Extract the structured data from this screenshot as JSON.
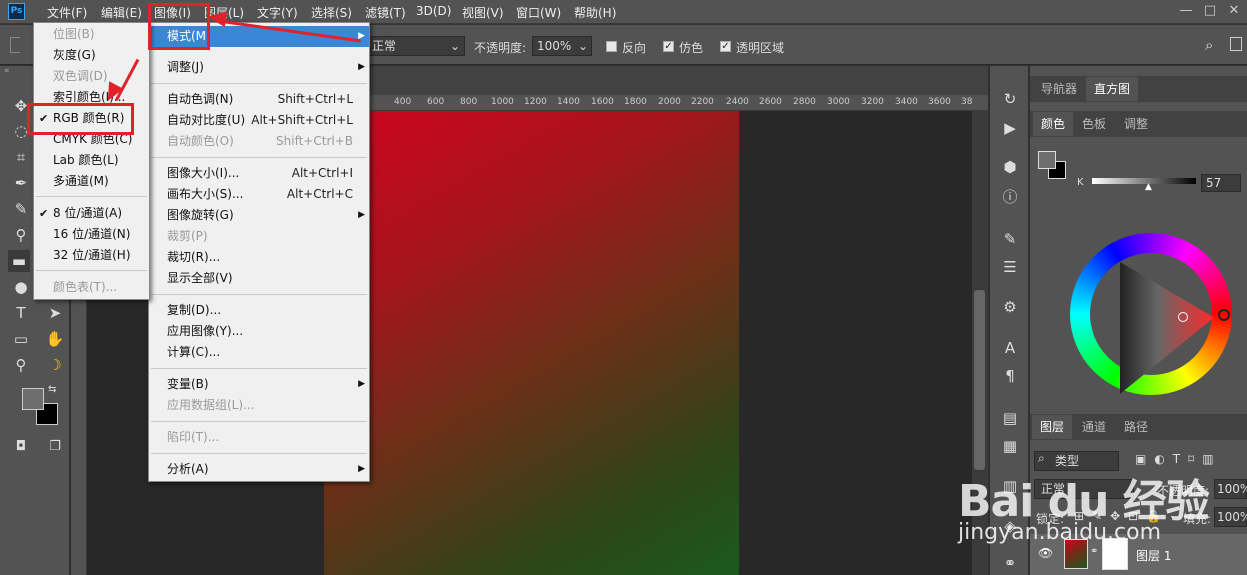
{
  "app": {
    "logo": "Ps"
  },
  "menubar": {
    "items": [
      "文件(F)",
      "编辑(E)",
      "图像(I)",
      "图层(L)",
      "文字(Y)",
      "选择(S)",
      "滤镜(T)",
      "3D(D)",
      "视图(V)",
      "窗口(W)",
      "帮助(H)"
    ],
    "window_controls": [
      "—",
      "□",
      "✕"
    ]
  },
  "options": {
    "mode_value": "正常",
    "opacity_label": "不透明度:",
    "opacity_value": "100%",
    "reverse_label": "反向",
    "dither_label": "仿色",
    "transparency_label": "透明区域"
  },
  "ruler": {
    "ticks": [
      "400",
      "600",
      "800",
      "1000",
      "1200",
      "1400",
      "1600",
      "1800",
      "2000",
      "2200",
      "2400",
      "2600",
      "2800",
      "3000",
      "3200",
      "3400",
      "3600",
      "38"
    ]
  },
  "image_menu": {
    "items": [
      {
        "label": "模式(M)",
        "shortcut": "",
        "disabled": false,
        "submenu": true,
        "highlight": true
      },
      {
        "label": "调整(J)",
        "shortcut": "",
        "disabled": false,
        "submenu": true
      },
      {
        "label": "自动色调(N)",
        "shortcut": "Shift+Ctrl+L",
        "disabled": false
      },
      {
        "label": "自动对比度(U)",
        "shortcut": "Alt+Shift+Ctrl+L",
        "disabled": false
      },
      {
        "label": "自动颜色(O)",
        "shortcut": "Shift+Ctrl+B",
        "disabled": true
      },
      {
        "label": "图像大小(I)...",
        "shortcut": "Alt+Ctrl+I",
        "disabled": false
      },
      {
        "label": "画布大小(S)...",
        "shortcut": "Alt+Ctrl+C",
        "disabled": false
      },
      {
        "label": "图像旋转(G)",
        "shortcut": "",
        "disabled": false,
        "submenu": true
      },
      {
        "label": "裁剪(P)",
        "shortcut": "",
        "disabled": true
      },
      {
        "label": "裁切(R)...",
        "shortcut": "",
        "disabled": false
      },
      {
        "label": "显示全部(V)",
        "shortcut": "",
        "disabled": false
      },
      {
        "label": "复制(D)...",
        "shortcut": "",
        "disabled": false
      },
      {
        "label": "应用图像(Y)...",
        "shortcut": "",
        "disabled": false
      },
      {
        "label": "计算(C)...",
        "shortcut": "",
        "disabled": false
      },
      {
        "label": "变量(B)",
        "shortcut": "",
        "disabled": false,
        "submenu": true
      },
      {
        "label": "应用数据组(L)...",
        "shortcut": "",
        "disabled": true
      },
      {
        "label": "陷印(T)...",
        "shortcut": "",
        "disabled": true
      },
      {
        "label": "分析(A)",
        "shortcut": "",
        "disabled": false,
        "submenu": true
      }
    ]
  },
  "mode_submenu": {
    "items": [
      {
        "label": "位图(B)",
        "disabled": true,
        "checked": false
      },
      {
        "label": "灰度(G)",
        "disabled": false,
        "checked": false
      },
      {
        "label": "双色调(D)",
        "disabled": true,
        "checked": false
      },
      {
        "label": "索引颜色(I)...",
        "disabled": false,
        "checked": false
      },
      {
        "label": "RGB 颜色(R)",
        "disabled": false,
        "checked": true
      },
      {
        "label": "CMYK 颜色(C)",
        "disabled": false,
        "checked": false
      },
      {
        "label": "Lab 颜色(L)",
        "disabled": false,
        "checked": false
      },
      {
        "label": "多通道(M)",
        "disabled": false,
        "checked": false
      },
      {
        "label": "8 位/通道(A)",
        "disabled": false,
        "checked": true
      },
      {
        "label": "16 位/通道(N)",
        "disabled": false,
        "checked": false
      },
      {
        "label": "32 位/通道(H)",
        "disabled": false,
        "checked": false
      },
      {
        "label": "颜色表(T)...",
        "disabled": true,
        "checked": false
      }
    ]
  },
  "right_panel": {
    "top_tabs": [
      "导航器",
      "直方图"
    ],
    "color_tabs": [
      "颜色",
      "色板",
      "调整"
    ],
    "k_label": "K",
    "k_value": "57",
    "layer_tabs": [
      "图层",
      "通道",
      "路径"
    ],
    "kind_label": "类型",
    "blend_value": "正常",
    "opacity_label": "不透明度:",
    "opacity_value": "100%",
    "lock_label": "锁定:",
    "fill_label": "填充:",
    "fill_value": "100%",
    "layer_name": "图层 1"
  },
  "watermark": {
    "brand": "Bai du 经验",
    "url": "jingyan.baidu.com"
  },
  "colors": {
    "highlight": "#3a87d6",
    "annotation_red": "#e0232a",
    "ui_gray": "#535353"
  }
}
